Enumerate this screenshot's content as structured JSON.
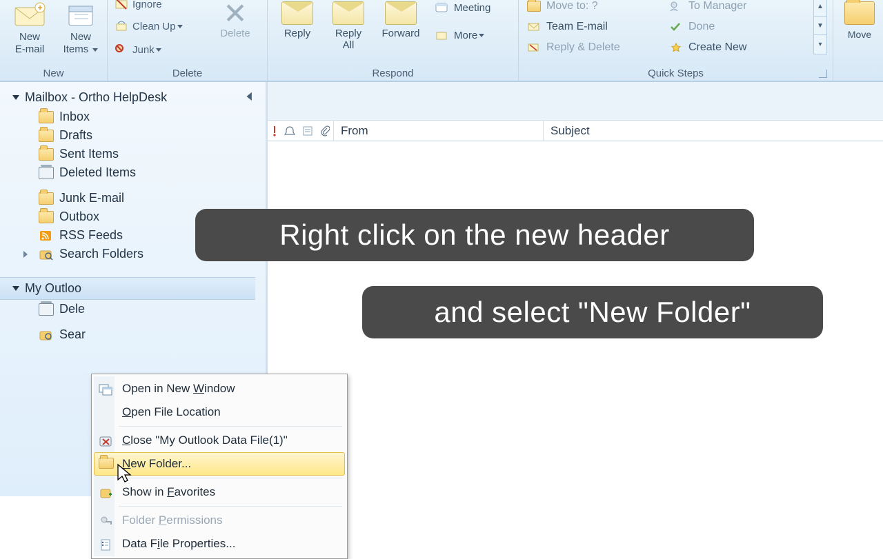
{
  "ribbon": {
    "groups": {
      "new": {
        "label": "New",
        "new_email": "New\nE-mail",
        "new_items": "New\nItems"
      },
      "delete": {
        "label": "Delete",
        "ignore": "Ignore",
        "cleanup": "Clean Up",
        "junk": "Junk",
        "delete": "Delete"
      },
      "respond": {
        "label": "Respond",
        "reply": "Reply",
        "reply_all": "Reply\nAll",
        "forward": "Forward",
        "meeting": "Meeting",
        "more": "More"
      },
      "quick": {
        "label": "Quick Steps",
        "move_to": "Move to: ?",
        "to_manager": "To Manager",
        "team_email": "Team E-mail",
        "done": "Done",
        "reply_delete": "Reply & Delete",
        "create_new": "Create New"
      },
      "move": {
        "move": "Move"
      }
    }
  },
  "nav": {
    "acct1": {
      "name": "Mailbox - Ortho HelpDesk",
      "folders": {
        "inbox": "Inbox",
        "drafts": "Drafts",
        "sent": "Sent Items",
        "deleted": "Deleted Items",
        "junk": "Junk E-mail",
        "outbox": "Outbox",
        "rss": "RSS Feeds",
        "search": "Search Folders"
      }
    },
    "acct2": {
      "name_visible": "My Outloo",
      "folders": {
        "deleted_visible": "Dele",
        "search_visible": "Sear"
      }
    }
  },
  "columns": {
    "from": "From",
    "subject": "Subject"
  },
  "context_menu": {
    "open_window_pre": "Open in New ",
    "open_window_u": "W",
    "open_window_post": "indow",
    "open_location_u": "O",
    "open_location_post": "pen File Location",
    "close_u": "C",
    "close_post": "lose \"My Outlook Data File(1)\"",
    "new_folder_u": "N",
    "new_folder_post": "ew Folder...",
    "show_fav_pre": "Show in ",
    "show_fav_u": "F",
    "show_fav_post": "avorites",
    "permissions_pre": "Folder ",
    "permissions_u": "P",
    "permissions_post": "ermissions",
    "properties_pre": "Data F",
    "properties_u": "i",
    "properties_post": "le Properties..."
  },
  "captions": {
    "line1": "Right click on the new header",
    "line2": "and select \"New Folder\""
  }
}
